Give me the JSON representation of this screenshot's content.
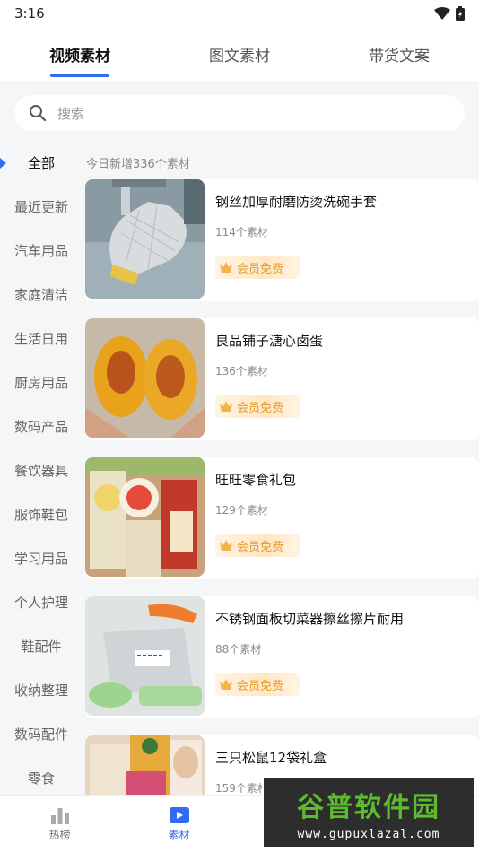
{
  "status_bar": {
    "time": "3:16"
  },
  "top_tabs": [
    {
      "label": "视频素材",
      "active": true
    },
    {
      "label": "图文素材",
      "active": false
    },
    {
      "label": "带货文案",
      "active": false
    }
  ],
  "search": {
    "placeholder": "搜索"
  },
  "sidebar": {
    "items": [
      {
        "label": "全部",
        "active": true
      },
      {
        "label": "最近更新"
      },
      {
        "label": "汽车用品"
      },
      {
        "label": "家庭清洁"
      },
      {
        "label": "生活日用"
      },
      {
        "label": "厨房用品"
      },
      {
        "label": "数码产品"
      },
      {
        "label": "餐饮器具"
      },
      {
        "label": "服饰鞋包"
      },
      {
        "label": "学习用品"
      },
      {
        "label": "个人护理"
      },
      {
        "label": "鞋配件"
      },
      {
        "label": "收纳整理"
      },
      {
        "label": "数码配件"
      },
      {
        "label": "零食"
      }
    ]
  },
  "content": {
    "header": "今日新增336个素材",
    "cards": [
      {
        "title": "钢丝加厚耐磨防烫洗碗手套",
        "count": "114个素材",
        "badge": "会员免费"
      },
      {
        "title": "良品铺子溏心卤蛋",
        "count": "136个素材",
        "badge": "会员免费"
      },
      {
        "title": "旺旺零食礼包",
        "count": "129个素材",
        "badge": "会员免费"
      },
      {
        "title": "不锈钢面板切菜器擦丝擦片耐用",
        "count": "88个素材",
        "badge": "会员免费"
      },
      {
        "title": "三只松鼠12袋礼盒",
        "count": "159个素材",
        "badge": ""
      }
    ]
  },
  "bottom_nav": [
    {
      "label": "热榜",
      "icon": "bar-chart-icon",
      "active": false
    },
    {
      "label": "素材",
      "icon": "video-icon",
      "active": true
    }
  ],
  "watermark": {
    "logo": "谷普软件园",
    "url": "www.gupuxlazal.com"
  },
  "colors": {
    "accent": "#2f6bf3",
    "vip": "#e49a2c"
  }
}
